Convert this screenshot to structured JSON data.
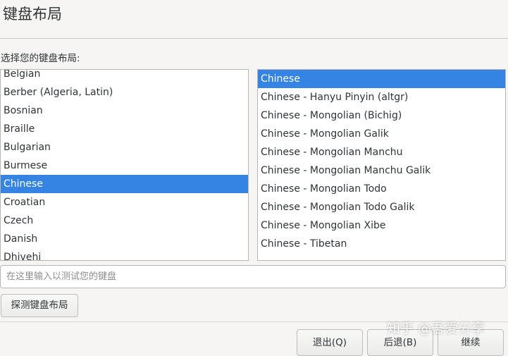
{
  "page": {
    "title": "键盘布局",
    "select_label": "选择您的键盘布局:"
  },
  "layouts": {
    "items": [
      "Belgian",
      "Berber (Algeria, Latin)",
      "Bosnian",
      "Braille",
      "Bulgarian",
      "Burmese",
      "Chinese",
      "Croatian",
      "Czech",
      "Danish",
      "Dhivehi"
    ],
    "selected": "Chinese"
  },
  "variants": {
    "items": [
      "Chinese",
      "Chinese - Hanyu Pinyin (altgr)",
      "Chinese - Mongolian (Bichig)",
      "Chinese - Mongolian Galik",
      "Chinese - Mongolian Manchu",
      "Chinese - Mongolian Manchu Galik",
      "Chinese - Mongolian Todo",
      "Chinese - Mongolian Todo Galik",
      "Chinese - Mongolian Xibe",
      "Chinese - Tibetan"
    ],
    "selected": "Chinese"
  },
  "test_input": {
    "placeholder": "在这里输入以测试您的键盘",
    "value": ""
  },
  "buttons": {
    "detect": "探测键盘布局",
    "quit": "退出(Q)",
    "back": "后退(B)",
    "continue": "继续"
  },
  "watermark": {
    "text": "知乎 @吾爱分享"
  },
  "colors": {
    "selection": "#3584e4",
    "background": "#f6f5f4"
  }
}
